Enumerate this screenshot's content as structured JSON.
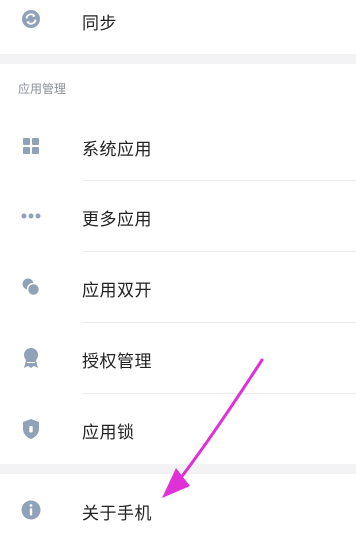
{
  "top_item": {
    "label": "同步",
    "icon": "sync-icon"
  },
  "section": {
    "title": "应用管理",
    "items": [
      {
        "label": "系统应用",
        "icon": "grid-icon"
      },
      {
        "label": "更多应用",
        "icon": "more-dots-icon"
      },
      {
        "label": "应用双开",
        "icon": "dual-app-icon"
      },
      {
        "label": "授权管理",
        "icon": "badge-icon"
      },
      {
        "label": "应用锁",
        "icon": "shield-lock-icon"
      }
    ]
  },
  "bottom_item": {
    "label": "关于手机",
    "icon": "info-icon"
  },
  "colors": {
    "icon": "#8fa2b8",
    "arrow": "#e030d8",
    "text": "#222222"
  }
}
